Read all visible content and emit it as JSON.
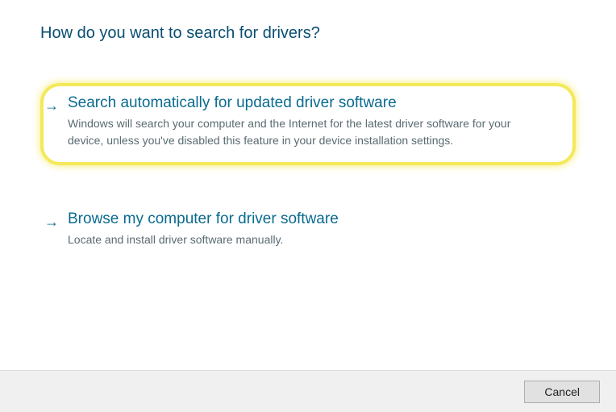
{
  "title": "How do you want to search for drivers?",
  "options": [
    {
      "title": "Search automatically for updated driver software",
      "description": "Windows will search your computer and the Internet for the latest driver software for your device, unless you've disabled this feature in your device installation settings.",
      "highlighted": true
    },
    {
      "title": "Browse my computer for driver software",
      "description": "Locate and install driver software manually.",
      "highlighted": false
    }
  ],
  "footer": {
    "cancel_label": "Cancel"
  }
}
